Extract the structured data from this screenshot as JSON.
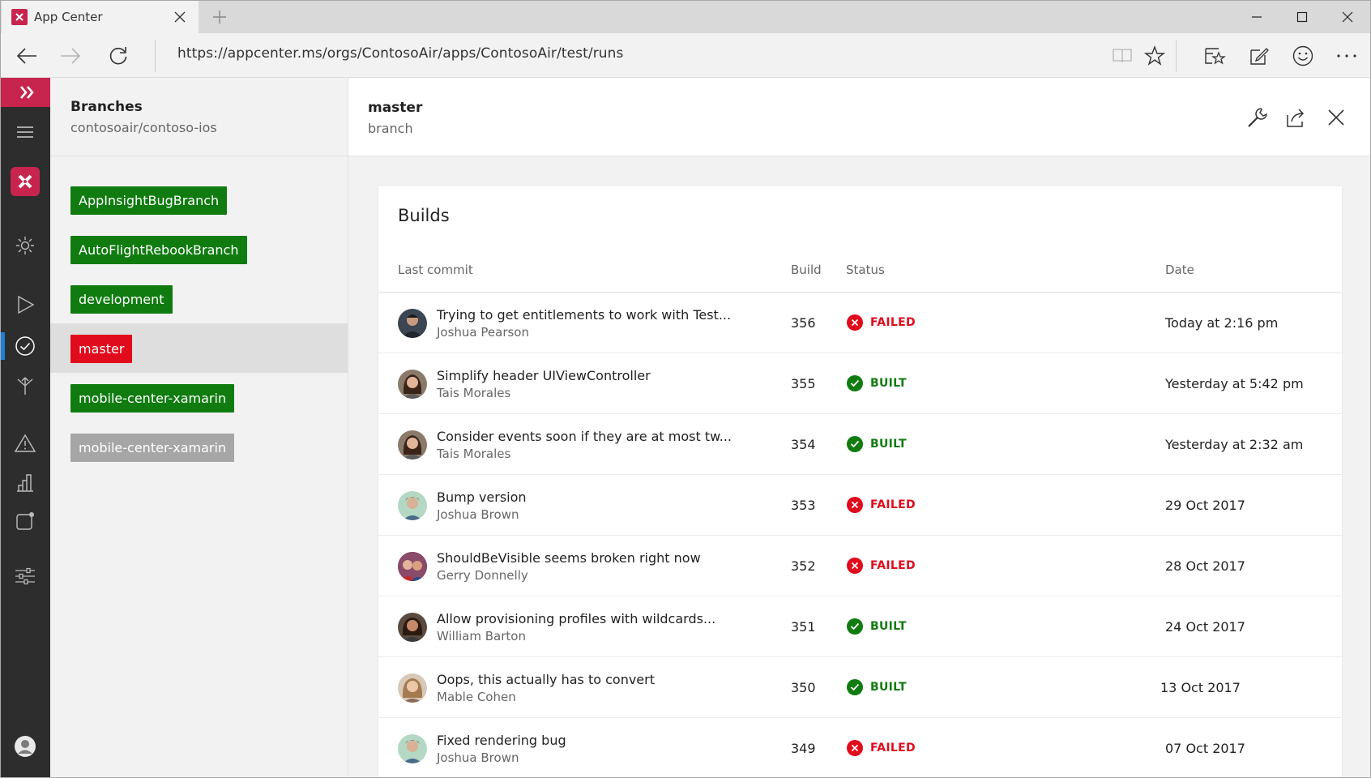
{
  "browser": {
    "tab_title": "App Center",
    "url": "https://appcenter.ms/orgs/ContosoAir/apps/ContosoAir/test/runs"
  },
  "branches": {
    "title": "Branches",
    "subtitle": "contosoair/contoso-ios",
    "items": [
      {
        "label": "AppInsightBugBranch",
        "color": "#107c10"
      },
      {
        "label": "AutoFlightRebookBranch",
        "color": "#107c10"
      },
      {
        "label": "development",
        "color": "#107c10"
      },
      {
        "label": "master",
        "color": "#e00b1c"
      },
      {
        "label": "mobile-center-xamarin",
        "color": "#107c10"
      },
      {
        "label": "mobile-center-xamarin",
        "color": "#a6a6a6"
      }
    ]
  },
  "main": {
    "title": "master",
    "subtitle": "branch"
  },
  "builds": {
    "title": "Builds",
    "columns": {
      "commit": "Last commit",
      "build": "Build",
      "status": "Status",
      "date": "Date"
    },
    "rows": [
      {
        "message": "Trying to get entitlements to work with Test...",
        "author": "Joshua Pearson",
        "build": "356",
        "status": "FAILED",
        "date": "Today at 2:16 pm"
      },
      {
        "message": "Simplify header UIViewController",
        "author": "Tais Morales",
        "build": "355",
        "status": "BUILT",
        "date": "Yesterday at 5:42 pm"
      },
      {
        "message": "Consider events soon if they are at most tw...",
        "author": "Tais Morales",
        "build": "354",
        "status": "BUILT",
        "date": "Yesterday at 2:32 am"
      },
      {
        "message": "Bump version",
        "author": "Joshua Brown",
        "build": "353",
        "status": "FAILED",
        "date": "29 Oct 2017"
      },
      {
        "message": "ShouldBeVisible seems broken right now",
        "author": "Gerry Donnelly",
        "build": "352",
        "status": "FAILED",
        "date": "28 Oct 2017"
      },
      {
        "message": "Allow provisioning profiles with wildcards...",
        "author": "William Barton",
        "build": "351",
        "status": "BUILT",
        "date": "24 Oct 2017"
      },
      {
        "message": "Oops, this actually has to convert",
        "author": "Mable Cohen",
        "build": "350",
        "status": "BUILT",
        "date": "13 Oct 2017"
      },
      {
        "message": "Fixed rendering bug",
        "author": "Joshua Brown",
        "build": "349",
        "status": "FAILED",
        "date": "07 Oct 2017"
      }
    ]
  },
  "colors": {
    "brand": "#c8254e",
    "failed": "#e00b1c",
    "built": "#107c10",
    "rail": "#2d2d2d",
    "active_indicator": "#1e7fd6"
  }
}
